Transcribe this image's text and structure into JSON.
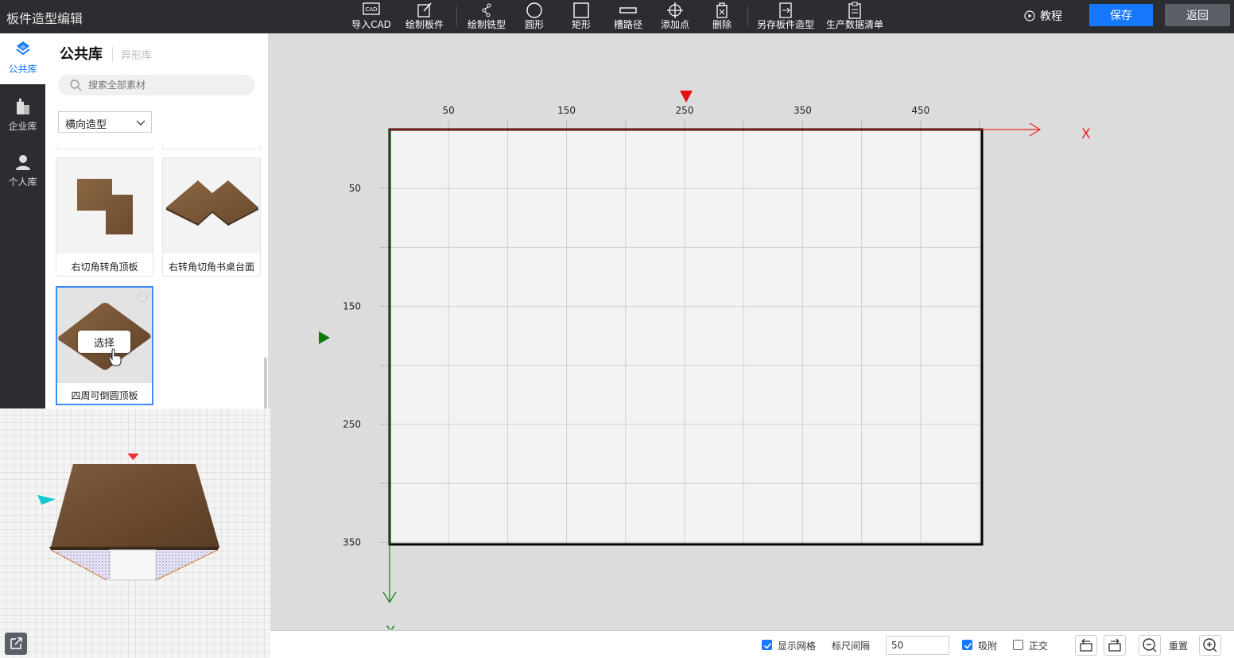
{
  "app": {
    "title": "板件造型编辑"
  },
  "toolbar": {
    "import_cad": "导入CAD",
    "draw_board": "绘制板件",
    "draw_mill": "绘制铣型",
    "circle": "圆形",
    "rect": "矩形",
    "groove_path": "槽路径",
    "add_point": "添加点",
    "delete": "删除",
    "save_as": "另存板件造型",
    "production_list": "生产数据清单",
    "tutorial": "教程",
    "save": "保存",
    "back": "返回"
  },
  "nav": {
    "public": "公共库",
    "enterprise": "企业库",
    "personal": "个人库"
  },
  "panel": {
    "title": "公共库",
    "subtitle": "异形库",
    "search_placeholder": "搜索全部素材",
    "select_value": "横向造型",
    "cards": [
      {
        "caption": "右切角转角顶板"
      },
      {
        "caption": "右转角切角书桌台面"
      },
      {
        "caption": "四周可倒圆顶板"
      }
    ],
    "select_button": "选择"
  },
  "canvas": {
    "x_ticks": [
      "50",
      "150",
      "250",
      "350",
      "450"
    ],
    "y_ticks": [
      "50",
      "150",
      "250",
      "350"
    ],
    "x_axis_label": "X",
    "y_axis_label": "Y"
  },
  "statusbar": {
    "show_grid": "显示网格",
    "ruler_spacing": "标尺间隔",
    "ruler_value": "50",
    "snap": "吸附",
    "ortho": "正交",
    "reset": "重置"
  },
  "colors": {
    "primary": "#1677ff",
    "topbar": "#2b2d31",
    "x_axis": "#ee2222",
    "y_axis": "#1a7a1a"
  }
}
